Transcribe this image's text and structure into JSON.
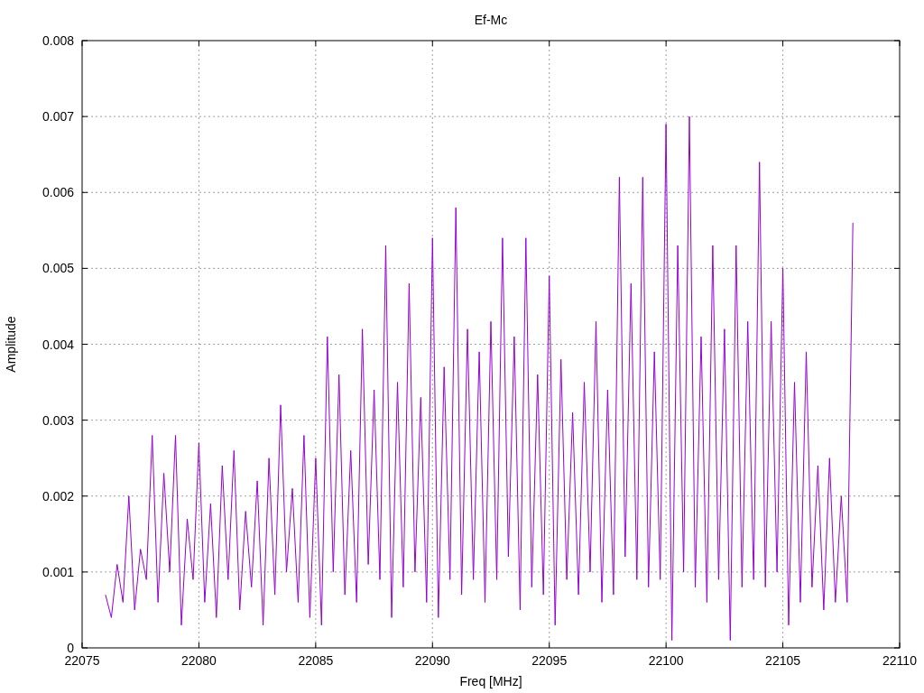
{
  "chart_data": {
    "type": "line",
    "title": "Ef-Mc",
    "xlabel": "Freq [MHz]",
    "ylabel": "Amplitude",
    "grid": true,
    "xlim": [
      22075,
      22110
    ],
    "ylim": [
      0,
      0.008
    ],
    "xticks": [
      22075,
      22080,
      22085,
      22090,
      22095,
      22100,
      22105,
      22110
    ],
    "yticks": [
      0,
      0.001,
      0.002,
      0.003,
      0.004,
      0.005,
      0.006,
      0.007,
      0.008
    ],
    "x": [
      22076,
      22076.25,
      22076.5,
      22076.75,
      22077,
      22077.25,
      22077.5,
      22077.75,
      22078,
      22078.25,
      22078.5,
      22078.75,
      22079,
      22079.25,
      22079.5,
      22079.75,
      22080,
      22080.25,
      22080.5,
      22080.75,
      22081,
      22081.25,
      22081.5,
      22081.75,
      22082,
      22082.25,
      22082.5,
      22082.75,
      22083,
      22083.25,
      22083.5,
      22083.75,
      22084,
      22084.25,
      22084.5,
      22084.75,
      22085,
      22085.25,
      22085.5,
      22085.75,
      22086,
      22086.25,
      22086.5,
      22086.75,
      22087,
      22087.25,
      22087.5,
      22087.75,
      22088,
      22088.25,
      22088.5,
      22088.75,
      22089,
      22089.25,
      22089.5,
      22089.75,
      22090,
      22090.25,
      22090.5,
      22090.75,
      22091,
      22091.25,
      22091.5,
      22091.75,
      22092,
      22092.25,
      22092.5,
      22092.75,
      22093,
      22093.25,
      22093.5,
      22093.75,
      22094,
      22094.25,
      22094.5,
      22094.75,
      22095,
      22095.25,
      22095.5,
      22095.75,
      22096,
      22096.25,
      22096.5,
      22096.75,
      22097,
      22097.25,
      22097.5,
      22097.75,
      22098,
      22098.25,
      22098.5,
      22098.75,
      22099,
      22099.25,
      22099.5,
      22099.75,
      22100,
      22100.25,
      22100.5,
      22100.75,
      22101,
      22101.25,
      22101.5,
      22101.75,
      22102,
      22102.25,
      22102.5,
      22102.75,
      22103,
      22103.25,
      22103.5,
      22103.75,
      22104,
      22104.25,
      22104.5,
      22104.75,
      22105,
      22105.25,
      22105.5,
      22105.75,
      22106,
      22106.25,
      22106.5,
      22106.75,
      22107,
      22107.25,
      22107.5,
      22107.75,
      22108
    ],
    "series": [
      {
        "color": "#9400d3",
        "values": [
          0.0007,
          0.0004,
          0.0011,
          0.0006,
          0.002,
          0.0005,
          0.0013,
          0.0009,
          0.0028,
          0.0006,
          0.0023,
          0.001,
          0.0028,
          0.0003,
          0.0017,
          0.0009,
          0.0027,
          0.0006,
          0.0019,
          0.0004,
          0.0024,
          0.0009,
          0.0026,
          0.0005,
          0.0018,
          0.0008,
          0.0022,
          0.0003,
          0.0025,
          0.0007,
          0.0032,
          0.001,
          0.0021,
          0.0006,
          0.0028,
          0.0004,
          0.0025,
          0.0003,
          0.0041,
          0.001,
          0.0036,
          0.0007,
          0.0026,
          0.0006,
          0.0042,
          0.0011,
          0.0034,
          0.0009,
          0.0053,
          0.0004,
          0.0035,
          0.0008,
          0.0048,
          0.001,
          0.0033,
          0.0006,
          0.0054,
          0.0004,
          0.0037,
          0.0009,
          0.0058,
          0.0007,
          0.0042,
          0.0009,
          0.0039,
          0.0006,
          0.0043,
          0.0009,
          0.0054,
          0.0012,
          0.0041,
          0.0005,
          0.0054,
          0.0008,
          0.0036,
          0.0007,
          0.0049,
          0.0003,
          0.0038,
          0.0009,
          0.0031,
          0.0007,
          0.0035,
          0.001,
          0.0043,
          0.0006,
          0.0034,
          0.0007,
          0.0062,
          0.0012,
          0.0048,
          0.0009,
          0.0062,
          0.0008,
          0.0039,
          0.0009,
          0.0069,
          0.0001,
          0.0053,
          0.001,
          0.007,
          0.0008,
          0.0041,
          0.0006,
          0.0053,
          0.0009,
          0.0042,
          0.0001,
          0.0053,
          0.0008,
          0.0043,
          0.0009,
          0.0064,
          0.0008,
          0.0043,
          0.001,
          0.005,
          0.0003,
          0.0035,
          0.0006,
          0.0039,
          0.0008,
          0.0024,
          0.0005,
          0.0025,
          0.0006,
          0.002,
          0.0006,
          0.0056
        ]
      }
    ]
  }
}
